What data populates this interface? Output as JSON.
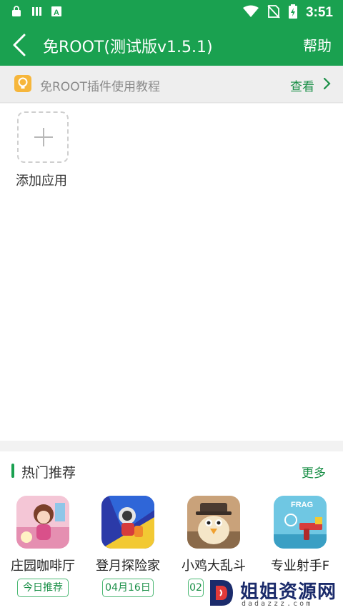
{
  "status_bar": {
    "time": "3:51",
    "icons": [
      "lock-notification-icon",
      "library-icon",
      "text-a-icon",
      "wifi-icon",
      "no-sim-icon",
      "battery-icon"
    ]
  },
  "app_bar": {
    "title": "免ROOT(测试版v1.5.1)",
    "help_label": "帮助"
  },
  "tip_bar": {
    "text": "免ROOT插件使用教程",
    "action_label": "查看"
  },
  "main": {
    "add_app_label": "添加应用"
  },
  "hot": {
    "title": "热门推荐",
    "more_label": "更多",
    "apps": [
      {
        "name": "庄园咖啡厅",
        "tag": "今日推荐"
      },
      {
        "name": "登月探险家",
        "tag": "04月16日"
      },
      {
        "name": "小鸡大乱斗",
        "tag": "02"
      },
      {
        "name": "专业射手F",
        "tag": ""
      }
    ]
  },
  "watermark": {
    "text": "姐姐资源网",
    "sub": "dadazzz.com"
  },
  "colors": {
    "brand_green": "#1aa150",
    "link_green": "#1a8f47",
    "bulb_yellow": "#f6b63b"
  }
}
